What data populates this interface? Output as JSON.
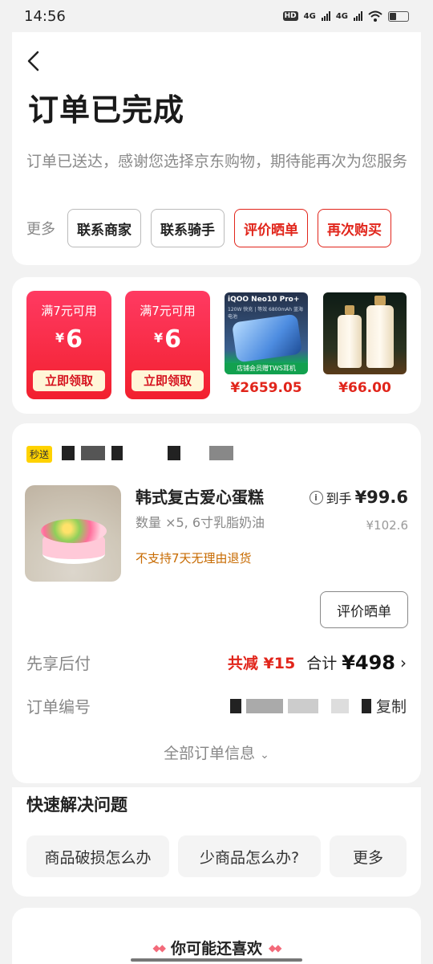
{
  "status_bar": {
    "time": "14:56",
    "hd": "HD",
    "net1": "4G",
    "net2": "4G"
  },
  "header": {
    "title": "订单已完成",
    "subtitle": "订单已送达，感谢您选择京东购物，期待能再次为您服务",
    "more_label": "更多",
    "actions": [
      "联系商家",
      "联系骑手",
      "评价晒单",
      "再次购买"
    ]
  },
  "promos": {
    "coupons": [
      {
        "condition": "满7元可用",
        "currency": "¥",
        "amount": "6",
        "button": "立即领取"
      },
      {
        "condition": "满7元可用",
        "currency": "¥",
        "amount": "6",
        "button": "立即领取"
      }
    ],
    "products": [
      {
        "image_text": "iQOO Neo10 Pro+",
        "image_sub": "120W 快充 | 等效 6800mAh 蓝海电池",
        "image_bottom": "店铺会员赠TWS耳机",
        "price": "¥2659.05"
      },
      {
        "price": "¥66.00"
      }
    ]
  },
  "order": {
    "shop_tag": "秒送",
    "product_name": "韩式复古爱心蛋糕",
    "product_spec": "数量 ×5, 6寸乳脂奶油",
    "product_note": "不支持7天无理由退货",
    "price_prefix": "到手",
    "price_now": "¥99.6",
    "price_orig": "¥102.6",
    "review_button": "评价晒单",
    "pay_label": "先享后付",
    "discount": "共减 ¥15",
    "total_label": "合计",
    "total_value": "¥498",
    "order_no_label": "订单编号",
    "copy_label": "复制",
    "all_info": "全部订单信息"
  },
  "quick": {
    "title": "快速解决问题",
    "buttons": [
      "商品破损怎么办",
      "少商品怎么办?",
      "更多"
    ]
  },
  "recommend": {
    "title": "你可能还喜欢"
  },
  "colors": {
    "accent": "#e1251b",
    "background": "#f2f2f2",
    "note": "#c76a00"
  }
}
